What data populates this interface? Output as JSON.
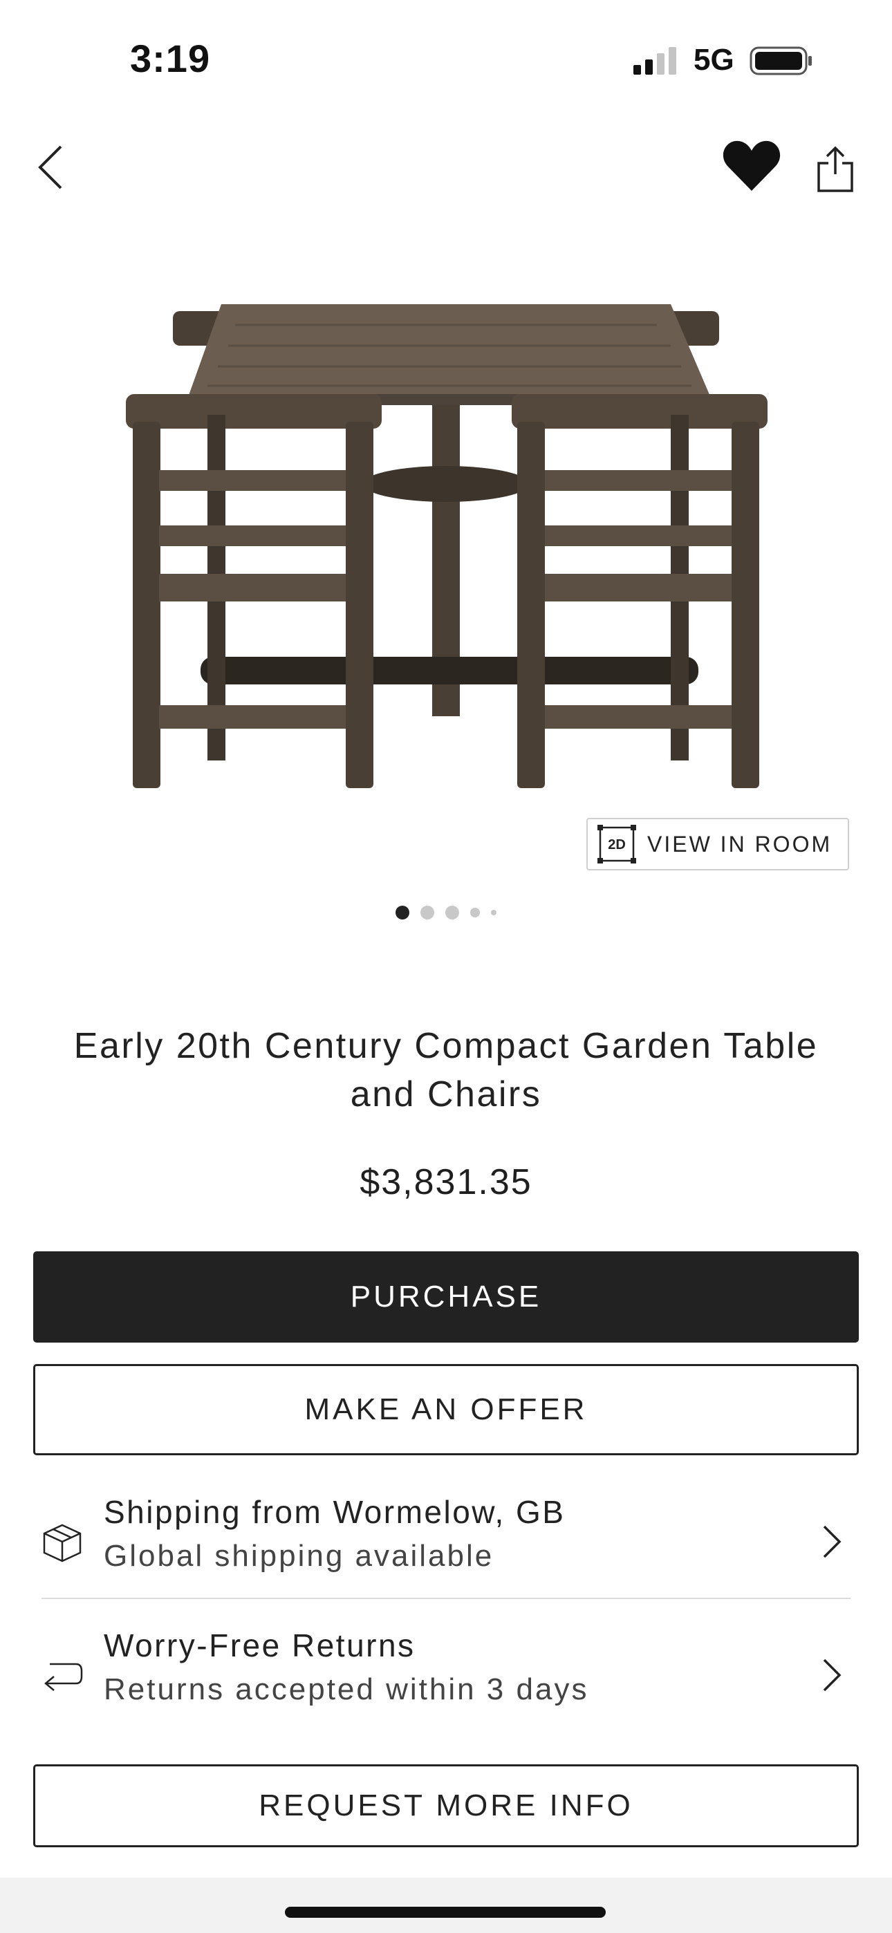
{
  "status_bar": {
    "time": "3:19",
    "network": "5G",
    "signal_bars": 4,
    "signal_bars_active": 2
  },
  "nav": {
    "back_icon": "chevron-left-icon",
    "favorite_icon": "heart-icon",
    "favorited": true,
    "share_icon": "share-icon"
  },
  "gallery": {
    "image_alt": "Garden table and chairs",
    "view_in_room_badge": "2D",
    "view_in_room_label": "VIEW IN ROOM",
    "image_count_dots": 5,
    "active_index": 0
  },
  "product": {
    "title": "Early 20th Century Compact Garden Table and Chairs",
    "price": "$3,831.35"
  },
  "actions": {
    "purchase_label": "PURCHASE",
    "offer_label": "MAKE AN OFFER",
    "request_info_label": "REQUEST MORE INFO"
  },
  "info_rows": [
    {
      "icon": "box-icon",
      "title": "Shipping from Wormelow, GB",
      "subtitle": "Global shipping available"
    },
    {
      "icon": "return-arrow-icon",
      "title": "Worry-Free Returns",
      "subtitle": "Returns accepted within 3 days"
    }
  ],
  "colors": {
    "primary_button": "#222222",
    "text": "#1f1f1f",
    "divider": "#dcdcdc"
  }
}
